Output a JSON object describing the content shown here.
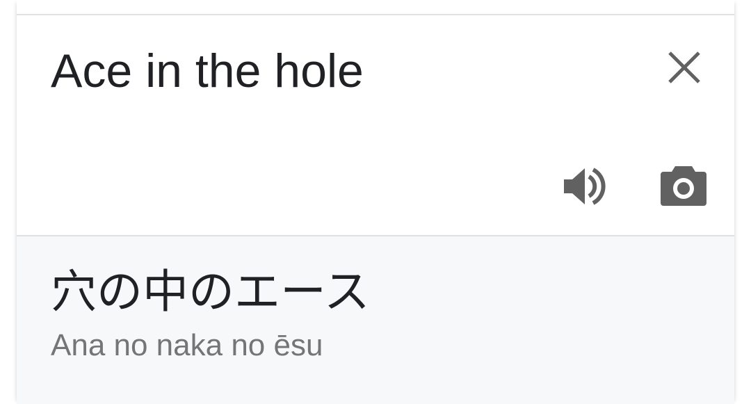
{
  "source": {
    "text": "Ace in the hole",
    "close_icon": "close-icon",
    "speak_icon": "volume-icon",
    "camera_icon": "camera-icon"
  },
  "result": {
    "translation": "穴の中のエース",
    "romanization": "Ana no naka no ēsu"
  },
  "colors": {
    "text_primary": "#202124",
    "text_secondary": "#757575",
    "icon": "#616161",
    "result_background": "#f7f8fa",
    "divider": "#e0e0e0"
  }
}
